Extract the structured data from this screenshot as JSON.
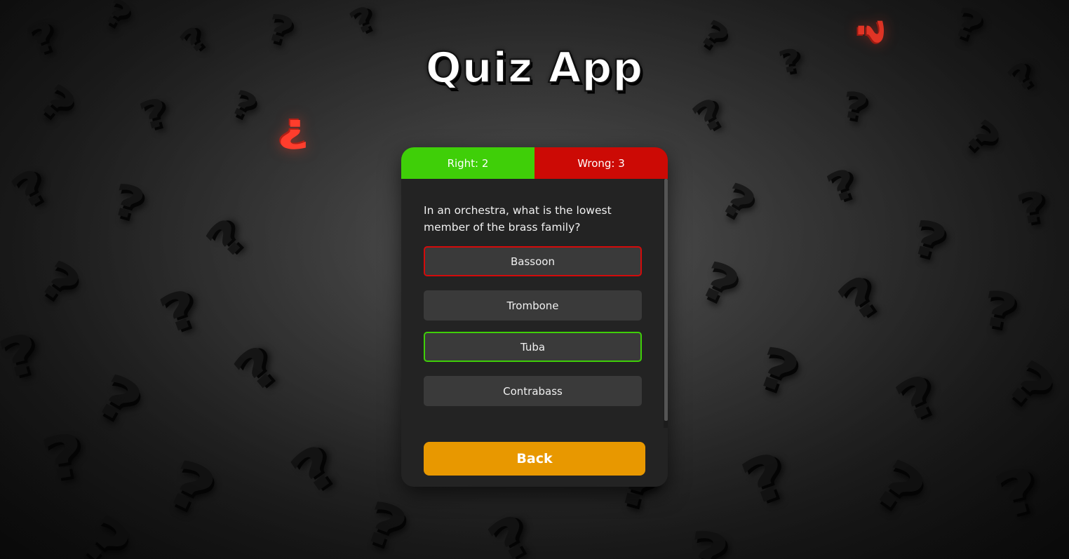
{
  "app": {
    "title": "Quiz App"
  },
  "score": {
    "right_label": "Right: 2",
    "wrong_label": "Wrong: 3"
  },
  "question": {
    "text": "In an orchestra, what is the lowest member of the brass family?"
  },
  "answers": [
    {
      "label": "Bassoon",
      "state": "incorrect"
    },
    {
      "label": "Trombone",
      "state": "neutral"
    },
    {
      "label": "Tuba",
      "state": "correct"
    },
    {
      "label": "Contrabass",
      "state": "neutral"
    }
  ],
  "back_button": {
    "label": "Back"
  },
  "colors": {
    "right": "#3fcf08",
    "wrong": "#cc0a05",
    "back": "#e89800",
    "card": "#232323",
    "answer": "#3a3a3a"
  },
  "background": {
    "motif": "question-mark-icon"
  }
}
